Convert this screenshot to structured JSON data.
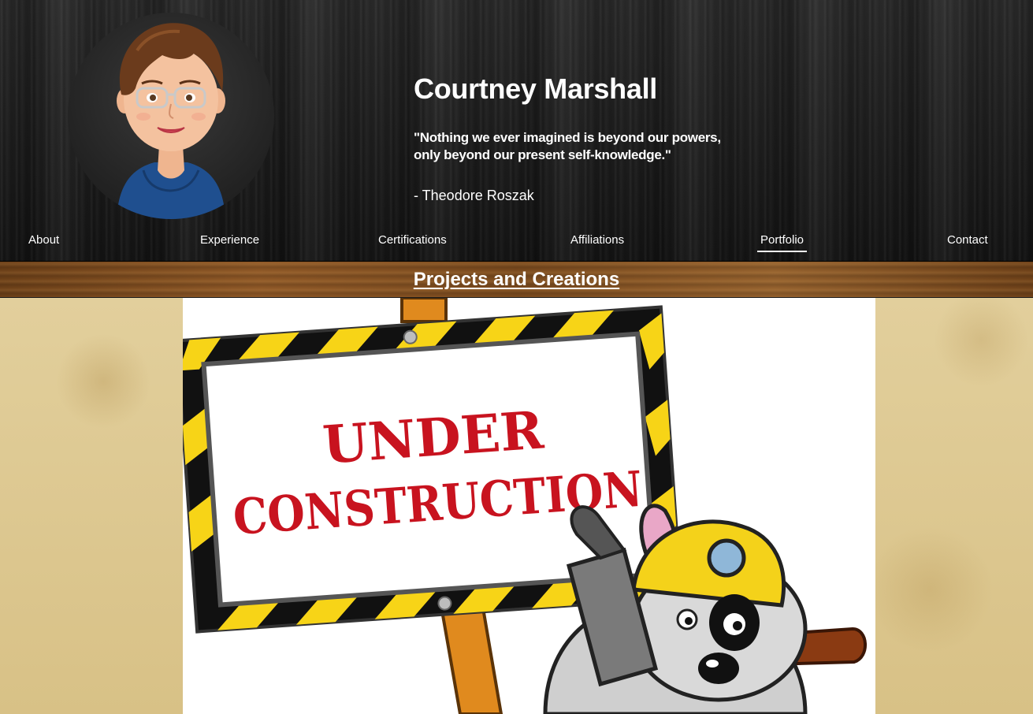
{
  "header": {
    "name": "Courtney Marshall",
    "quote": "\"Nothing we ever imagined is beyond our powers, only beyond our present self-knowledge.\"",
    "quote_author": "- Theodore Roszak"
  },
  "nav": {
    "items": [
      {
        "label": "About"
      },
      {
        "label": "Experience"
      },
      {
        "label": "Certifications"
      },
      {
        "label": "Affiliations"
      },
      {
        "label": "Portfolio",
        "active": true
      },
      {
        "label": "Contact"
      }
    ]
  },
  "section": {
    "title": "Projects and Creations"
  },
  "construction_image": {
    "line1": "UNDER",
    "line2": "CONSTRUCTION"
  },
  "icons": {
    "avatar": "cartoon-woman-avatar-icon",
    "construction": "under-construction-sign-dog-icon"
  }
}
